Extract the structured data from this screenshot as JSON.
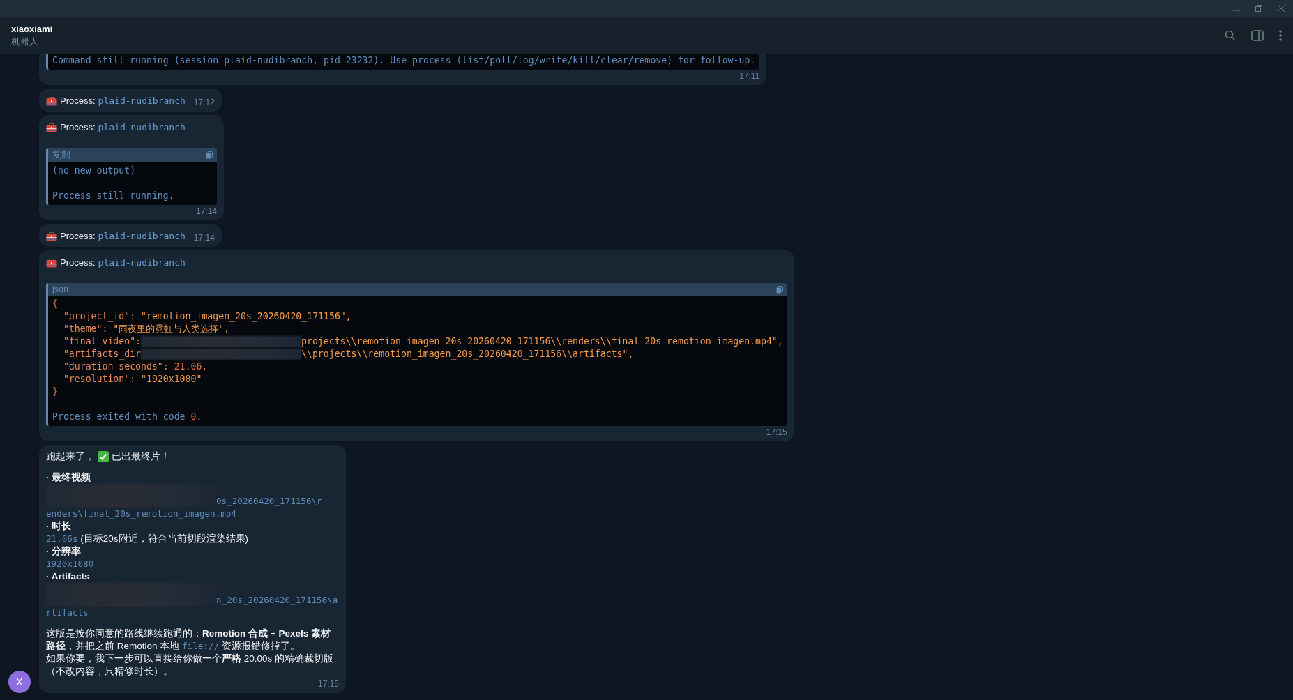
{
  "chat_header": {
    "title": "xiaoxiami",
    "subtitle": "机器人"
  },
  "messages": [
    {
      "code": {
        "lines": [
          [
            {
              "kind": "text",
              "text": "Command still running (session plaid-nudibranch, pid 23232). Use process (list/poll/log/write/kill/clear/remove) for follow-up."
            }
          ]
        ]
      },
      "time": "17:11"
    },
    {
      "process": {
        "label": "Process:",
        "name": "plaid-nudibranch"
      },
      "time": "17:12"
    },
    {
      "process": {
        "label": "Process:",
        "name": "plaid-nudibranch"
      },
      "code": {
        "language": "复制",
        "lines": [
          [
            {
              "kind": "text",
              "text": "(no new output)"
            }
          ],
          [
            {
              "kind": "blank"
            }
          ],
          [
            {
              "kind": "text",
              "text": "Process still running."
            }
          ]
        ]
      },
      "time": "17:14"
    },
    {
      "process": {
        "label": "Process:",
        "name": "plaid-nudibranch"
      },
      "time": "17:14"
    },
    {
      "process": {
        "label": "Process:",
        "name": "plaid-nudibranch"
      },
      "code": {
        "language": "json",
        "lines": [
          [
            {
              "kind": "punct",
              "text": "{"
            }
          ],
          [
            {
              "kind": "key",
              "text": "  \"project_id\": "
            },
            {
              "kind": "string",
              "text": "\"remotion_imagen_20s_20260420_171156\","
            }
          ],
          [
            {
              "kind": "key",
              "text": "  \"theme\": "
            },
            {
              "kind": "string",
              "text": "\"雨夜里的霓虹与人类选择\","
            }
          ],
          [
            {
              "kind": "key",
              "text": "  \"final_video\":"
            },
            {
              "kind": "redacted"
            },
            {
              "kind": "string",
              "text": "projects\\\\remotion_imagen_20s_20260420_171156\\\\renders\\\\final_20s_remotion_imagen.mp4\","
            }
          ],
          [
            {
              "kind": "key",
              "text": "  \"artifacts_dir"
            },
            {
              "kind": "redacted"
            },
            {
              "kind": "string",
              "text": "\\\\projects\\\\remotion_imagen_20s_20260420_171156\\\\artifacts\","
            }
          ],
          [
            {
              "kind": "key",
              "text": "  \"duration_seconds\": "
            },
            {
              "kind": "number",
              "text": "21.06,"
            }
          ],
          [
            {
              "kind": "key",
              "text": "  \"resolution\": "
            },
            {
              "kind": "string",
              "text": "\"1920x1080\""
            }
          ],
          [
            {
              "kind": "punct",
              "text": "}"
            }
          ],
          [
            {
              "kind": "blank"
            }
          ],
          [
            {
              "kind": "text",
              "text": "Process exited with code "
            },
            {
              "kind": "number",
              "text": "0"
            },
            {
              "kind": "text",
              "text": "."
            }
          ]
        ]
      },
      "time": "17:15"
    },
    {
      "avatar": "X",
      "body": [
        {
          "kind": "status",
          "before": "跑起来了，",
          "after": "已出最终片！"
        },
        {
          "kind": "spacer"
        },
        {
          "kind": "bullet",
          "text": "· 最终视频"
        },
        {
          "kind": "redacted_path",
          "tail": "0s_20260420_171156\\r"
        },
        {
          "kind": "mono",
          "text": "enders\\final_20s_remotion_imagen.mp4"
        },
        {
          "kind": "bullet",
          "text": "· 时长"
        },
        {
          "kind": "mono_note",
          "mono": "21.06s",
          "note": "(目标20s附近，符合当前切段渲染结果)"
        },
        {
          "kind": "bullet",
          "text": "· 分辨率"
        },
        {
          "kind": "mono",
          "text": "1920x1080"
        },
        {
          "kind": "bullet",
          "text": "· Artifacts"
        },
        {
          "kind": "redacted_path",
          "tail": "n_20s_20260420_171156\\a"
        },
        {
          "kind": "mono",
          "text": "rtifacts"
        },
        {
          "kind": "spacer"
        },
        {
          "kind": "paragraph",
          "parts": [
            {
              "text": "这版是按你同意的路线继续跑通的：**Remotion 合成** + **Pexels 素材路径**，并把之前 Remotion 本地 "
            },
            {
              "code": "file://"
            },
            {
              "text": " 资源报错修掉了。"
            }
          ]
        },
        {
          "kind": "paragraph",
          "parts": [
            {
              "text": "如果你要，我下一步可以直接给你做一个**严格** 20.00s 的精确裁切版（不改内容，只精修时长）。"
            }
          ]
        }
      ],
      "time": "17:15"
    }
  ]
}
